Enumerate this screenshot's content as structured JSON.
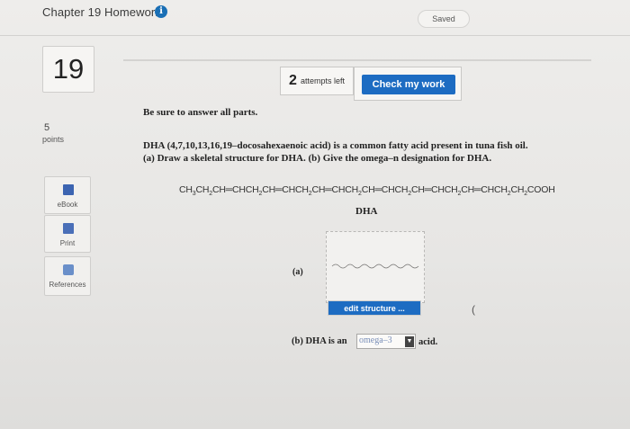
{
  "header": {
    "title": "Chapter 19 Homework",
    "info_icon": "info-icon",
    "saved": "Saved"
  },
  "question": {
    "number": "19",
    "points_value": "5",
    "points_label": "points"
  },
  "toolbar": {
    "attempts_count": "2",
    "attempts_label": "attempts left",
    "check_label": "Check my work"
  },
  "sidebar": {
    "items": [
      {
        "label": "eBook",
        "icon": "ebook-icon"
      },
      {
        "label": "Print",
        "icon": "print-icon"
      },
      {
        "label": "References",
        "icon": "references-icon"
      }
    ]
  },
  "body": {
    "instructions": "Be sure to answer all parts.",
    "line1": "DHA (4,7,10,13,16,19–docosahexaenoic acid) is a common fatty acid present in tuna fish oil.",
    "line2": "(a) Draw a skeletal structure for DHA. (b) Give the omega–n designation for DHA.",
    "molecule_label": "DHA",
    "part_a_label": "(a)",
    "edit_structure": "edit structure ...",
    "part_b_prefix": "(b) DHA is an",
    "omega_selected": "omega–3",
    "part_b_suffix": "acid.",
    "stray_mark": "("
  },
  "colors": {
    "accent": "#1d6cc2",
    "info": "#1a6fb5"
  }
}
